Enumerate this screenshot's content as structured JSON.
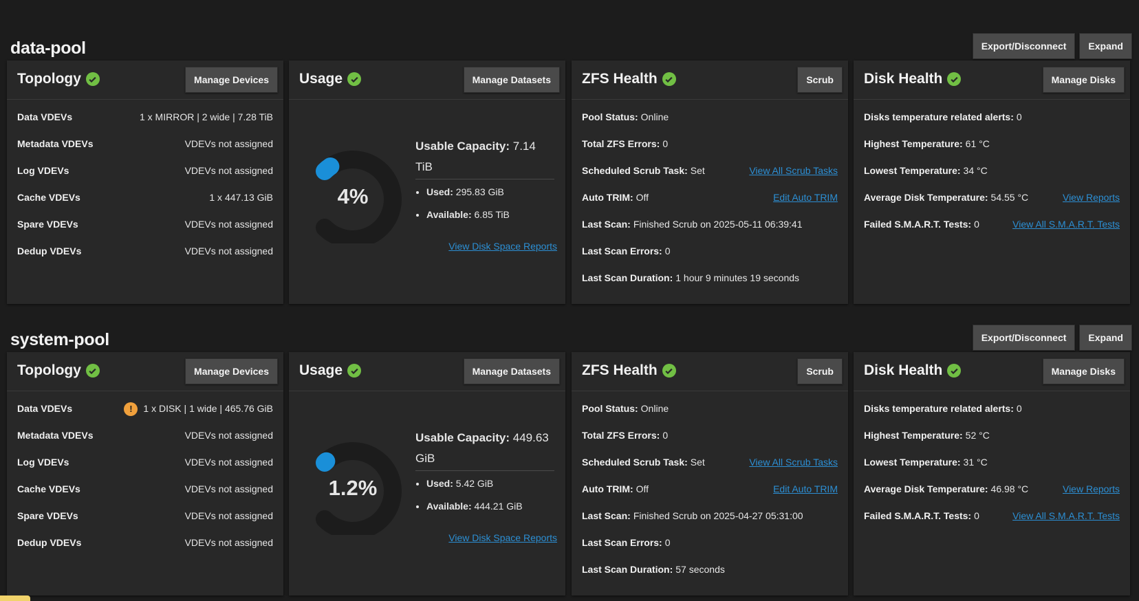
{
  "pools": [
    {
      "name": "data-pool",
      "actions": {
        "export": "Export/Disconnect",
        "expand": "Expand"
      },
      "topology": {
        "title": "Topology",
        "button": "Manage Devices",
        "rows": [
          {
            "key": "Data VDEVs",
            "value": "1 x MIRROR | 2 wide | 7.28 TiB"
          },
          {
            "key": "Metadata VDEVs",
            "value": "VDEVs not assigned"
          },
          {
            "key": "Log VDEVs",
            "value": "VDEVs not assigned"
          },
          {
            "key": "Cache VDEVs",
            "value": "1 x 447.13 GiB"
          },
          {
            "key": "Spare VDEVs",
            "value": "VDEVs not assigned"
          },
          {
            "key": "Dedup VDEVs",
            "value": "VDEVs not assigned"
          }
        ]
      },
      "usage": {
        "title": "Usage",
        "button": "Manage Datasets",
        "percent_label": "4%",
        "percent_value": 4,
        "capacity_label": "Usable Capacity:",
        "capacity_value": "7.14 TiB",
        "used_label": "Used:",
        "used_value": "295.83 GiB",
        "available_label": "Available:",
        "available_value": "6.85 TiB",
        "link": "View Disk Space Reports"
      },
      "zfs": {
        "title": "ZFS Health",
        "button": "Scrub",
        "rows": [
          {
            "key": "Pool Status:",
            "value": "Online",
            "link": ""
          },
          {
            "key": "Total ZFS Errors:",
            "value": "0",
            "link": ""
          },
          {
            "key": "Scheduled Scrub Task:",
            "value": "Set",
            "link": "View All Scrub Tasks"
          },
          {
            "key": "Auto TRIM:",
            "value": "Off",
            "link": "Edit Auto TRIM"
          },
          {
            "key": "Last Scan:",
            "value": "Finished Scrub on 2025-05-11 06:39:41",
            "link": ""
          },
          {
            "key": "Last Scan Errors:",
            "value": "0",
            "link": ""
          },
          {
            "key": "Last Scan Duration:",
            "value": "1 hour 9 minutes 19 seconds",
            "link": ""
          }
        ]
      },
      "disk": {
        "title": "Disk Health",
        "button": "Manage Disks",
        "rows": [
          {
            "key": "Disks temperature related alerts:",
            "value": "0",
            "link": ""
          },
          {
            "key": "Highest Temperature:",
            "value": "61 °C",
            "link": ""
          },
          {
            "key": "Lowest Temperature:",
            "value": "34 °C",
            "link": ""
          },
          {
            "key": "Average Disk Temperature:",
            "value": "54.55 °C",
            "link": "View Reports"
          },
          {
            "key": "Failed S.M.A.R.T. Tests:",
            "value": "0",
            "link": "View All S.M.A.R.T. Tests"
          }
        ]
      }
    },
    {
      "name": "system-pool",
      "actions": {
        "export": "Export/Disconnect",
        "expand": "Expand"
      },
      "topology": {
        "title": "Topology",
        "button": "Manage Devices",
        "rows": [
          {
            "key": "Data VDEVs",
            "value": "1 x DISK | 1 wide | 465.76 GiB",
            "warn": "!"
          },
          {
            "key": "Metadata VDEVs",
            "value": "VDEVs not assigned"
          },
          {
            "key": "Log VDEVs",
            "value": "VDEVs not assigned"
          },
          {
            "key": "Cache VDEVs",
            "value": "VDEVs not assigned"
          },
          {
            "key": "Spare VDEVs",
            "value": "VDEVs not assigned"
          },
          {
            "key": "Dedup VDEVs",
            "value": "VDEVs not assigned"
          }
        ]
      },
      "usage": {
        "title": "Usage",
        "button": "Manage Datasets",
        "percent_label": "1.2%",
        "percent_value": 1.2,
        "capacity_label": "Usable Capacity:",
        "capacity_value": "449.63 GiB",
        "used_label": "Used:",
        "used_value": "5.42 GiB",
        "available_label": "Available:",
        "available_value": "444.21 GiB",
        "link": "View Disk Space Reports"
      },
      "zfs": {
        "title": "ZFS Health",
        "button": "Scrub",
        "rows": [
          {
            "key": "Pool Status:",
            "value": "Online",
            "link": ""
          },
          {
            "key": "Total ZFS Errors:",
            "value": "0",
            "link": ""
          },
          {
            "key": "Scheduled Scrub Task:",
            "value": "Set",
            "link": "View All Scrub Tasks"
          },
          {
            "key": "Auto TRIM:",
            "value": "Off",
            "link": "Edit Auto TRIM"
          },
          {
            "key": "Last Scan:",
            "value": "Finished Scrub on 2025-04-27 05:31:00",
            "link": ""
          },
          {
            "key": "Last Scan Errors:",
            "value": "0",
            "link": ""
          },
          {
            "key": "Last Scan Duration:",
            "value": "57 seconds",
            "link": ""
          }
        ]
      },
      "disk": {
        "title": "Disk Health",
        "button": "Manage Disks",
        "rows": [
          {
            "key": "Disks temperature related alerts:",
            "value": "0",
            "link": ""
          },
          {
            "key": "Highest Temperature:",
            "value": "52 °C",
            "link": ""
          },
          {
            "key": "Lowest Temperature:",
            "value": "31 °C",
            "link": ""
          },
          {
            "key": "Average Disk Temperature:",
            "value": "46.98 °C",
            "link": "View Reports"
          },
          {
            "key": "Failed S.M.A.R.T. Tests:",
            "value": "0",
            "link": "View All S.M.A.R.T. Tests"
          }
        ]
      }
    }
  ],
  "colors": {
    "ok": "#71bf44",
    "warn": "#f0a03c",
    "gauge_fill": "#1a8fd8",
    "gauge_track": "#1c1c1c",
    "link": "#2c8fd4"
  },
  "icons": {
    "ok": "check-circle-icon",
    "warn": "exclamation-circle-icon"
  }
}
